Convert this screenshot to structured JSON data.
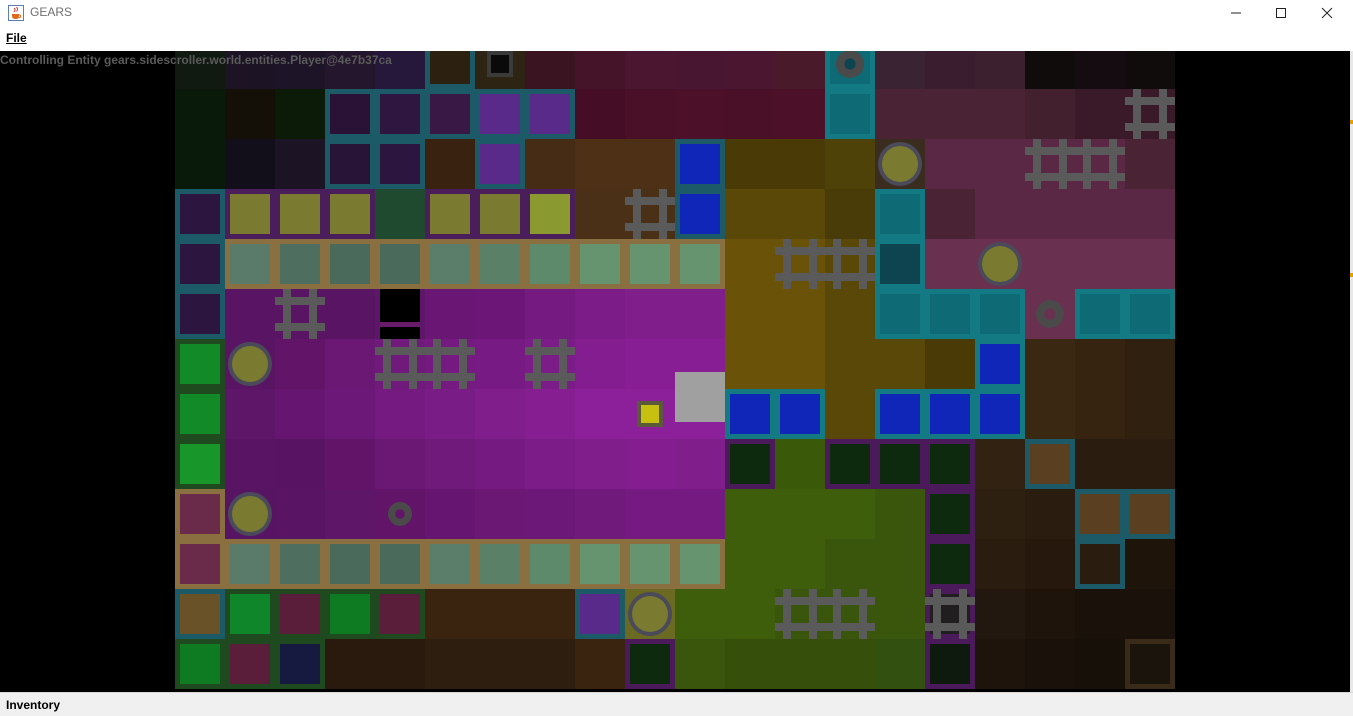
{
  "window": {
    "title": "GEARS",
    "icon": "java-cup-icon",
    "controls": [
      "minimize-icon",
      "maximize-icon",
      "close-icon"
    ]
  },
  "menu": {
    "file_label": "File"
  },
  "game": {
    "status_text": "Controlling Entity gears.sidescroller.world.entities.Player@4e7b37ca",
    "player_color": "#c8c010",
    "background": "#000000"
  },
  "bottom": {
    "inventory_label": "Inventory"
  }
}
